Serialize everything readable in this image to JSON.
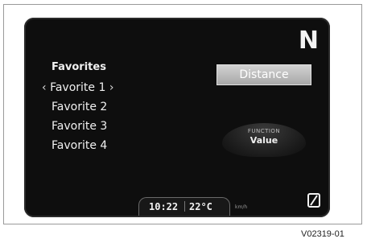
{
  "display": {
    "gear_indicator": "N",
    "menu": {
      "title": "Favorites",
      "items": [
        "Favorite 1",
        "Favorite 2",
        "Favorite 3",
        "Favorite 4"
      ],
      "selected_index": 0,
      "prev_chevron": "‹",
      "next_chevron": "›"
    },
    "distance_button_label": "Distance",
    "function_panel": {
      "label": "FUNCTION",
      "value": "Value"
    },
    "status": {
      "time": "10:22",
      "temperature": "22°C",
      "speed_unit": "km/h"
    },
    "icons": {
      "bottom_right": "zero-indicator-icon"
    }
  },
  "caption": "V02319-01",
  "colors": {
    "screen_background": "#0e0e0e",
    "text": "#f0f0f0",
    "button_gray": "#b8b8b8"
  }
}
